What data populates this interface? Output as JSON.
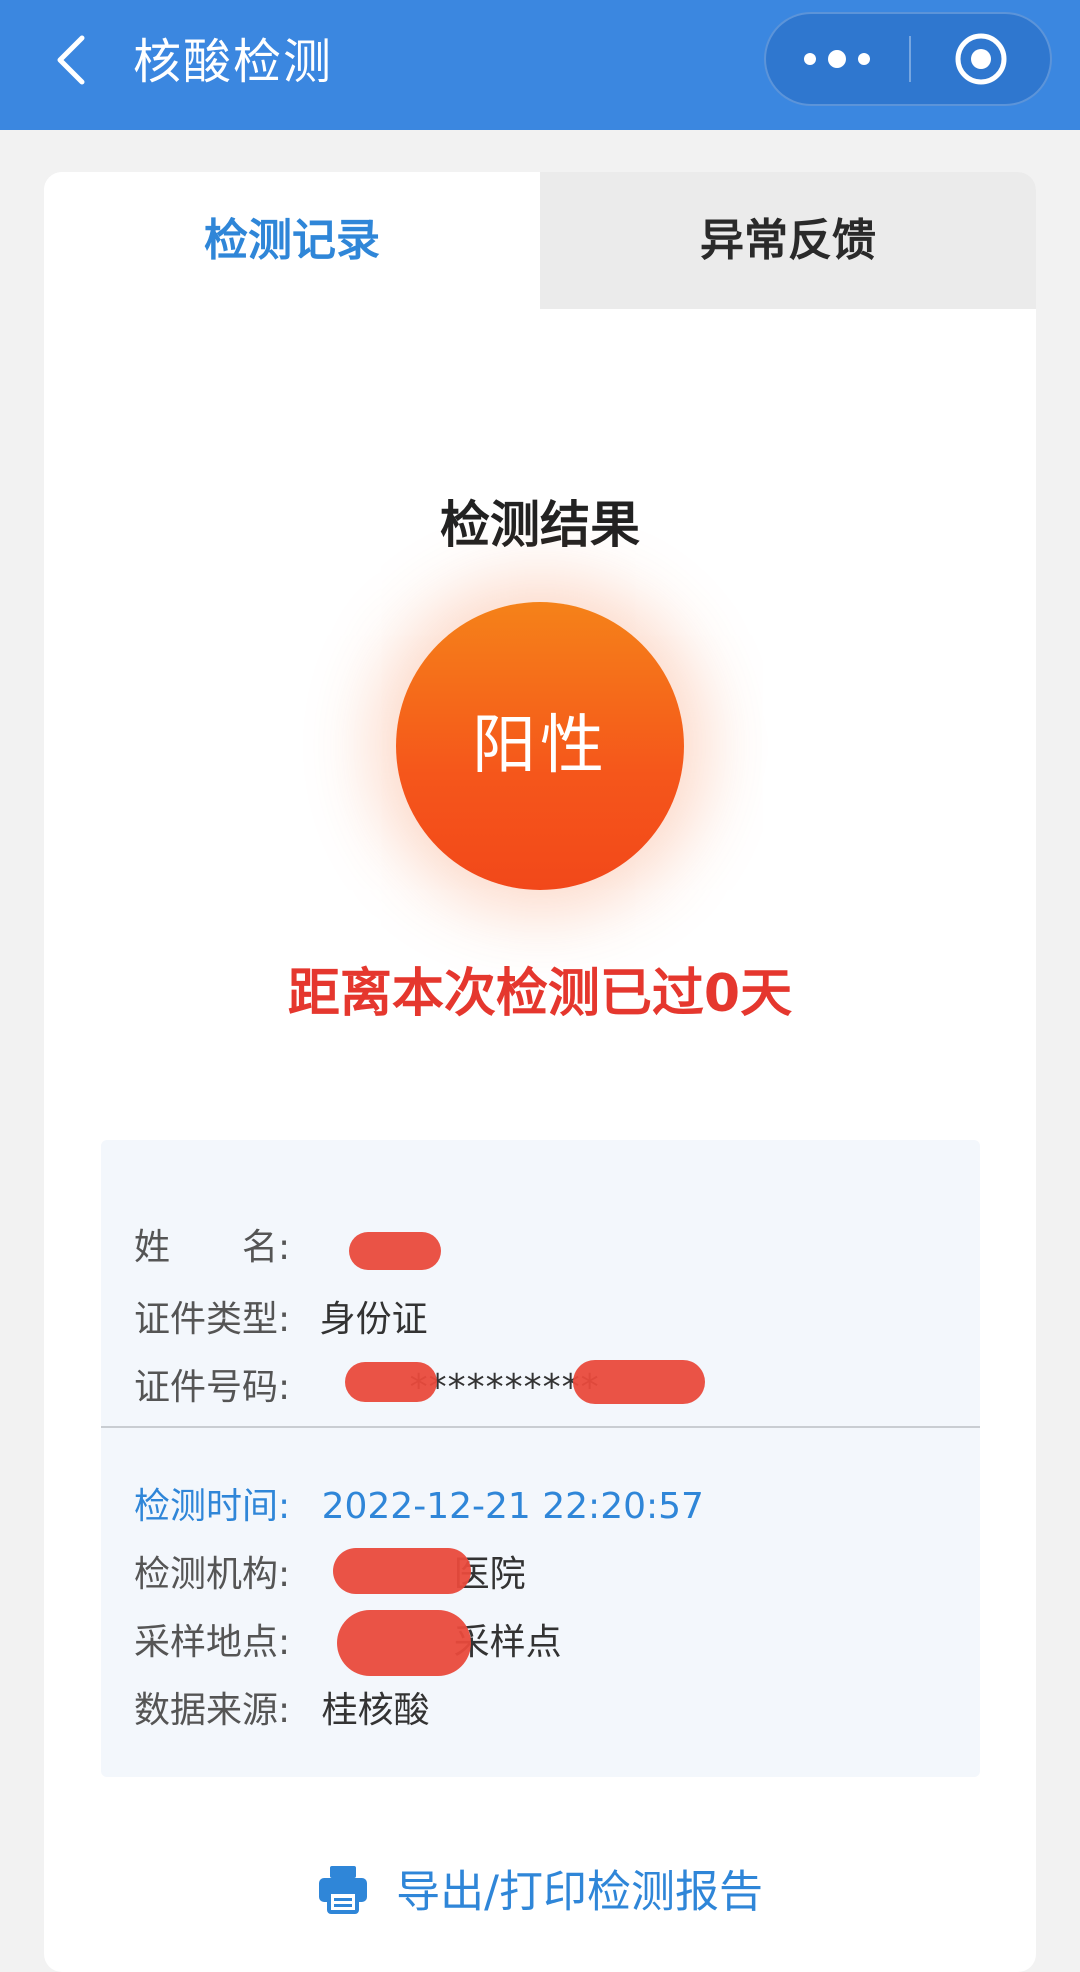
{
  "navbar": {
    "title": "核酸检测"
  },
  "tabs": [
    {
      "label": "检测记录",
      "active": true
    },
    {
      "label": "异常反馈",
      "active": false
    }
  ],
  "result": {
    "title": "检测结果",
    "status": "阳性",
    "days_text": "距离本次检测已过0天"
  },
  "person": {
    "name_label": "姓　　名:",
    "id_type_label": "证件类型:",
    "id_type_value": "身份证",
    "id_number_label": "证件号码:",
    "id_number_value": "**********"
  },
  "test": {
    "time_label": "检测时间:",
    "time_value": "2022-12-21 22:20:57",
    "org_label": "检测机构:",
    "org_value_suffix": "医院",
    "site_label": "采样地点:",
    "site_value_suffix": "采样点",
    "source_label": "数据来源:",
    "source_value": "桂核酸"
  },
  "export": {
    "label": "导出/打印检测报告"
  },
  "colors": {
    "navbar": "#3b87e0",
    "accent_blue": "#2f86d8",
    "result_orange": "#f5561b",
    "alert_red": "#e5372e"
  },
  "icons": [
    "back-arrow-icon",
    "more-dots-icon",
    "close-target-icon",
    "printer-icon"
  ]
}
